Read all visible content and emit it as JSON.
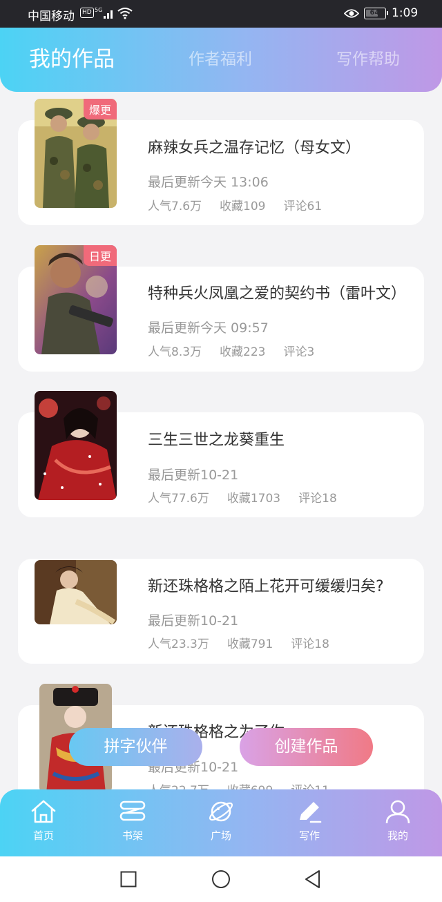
{
  "status_bar": {
    "carrier": "中国移动",
    "hd": "HD",
    "network": "5G",
    "battery": "64",
    "battery_level": 0.64,
    "time": "1:09"
  },
  "header": {
    "tabs": [
      {
        "label": "我的作品"
      },
      {
        "label": "作者福利"
      },
      {
        "label": "写作帮助"
      }
    ]
  },
  "works": [
    {
      "title": "麻辣女兵之温存记忆（母女文）",
      "update": "最后更新今天 13:06",
      "popularity": "人气7.6万",
      "favorites": "收藏109",
      "comments": "评论61",
      "badge": "爆更"
    },
    {
      "title": "特种兵火凤凰之爱的契约书（雷叶文）",
      "update": "最后更新今天 09:57",
      "popularity": "人气8.3万",
      "favorites": "收藏223",
      "comments": "评论3",
      "badge": "日更"
    },
    {
      "title": "三生三世之龙葵重生",
      "update": "最后更新10-21",
      "popularity": "人气77.6万",
      "favorites": "收藏1703",
      "comments": "评论18"
    },
    {
      "title": "新还珠格格之陌上花开可缓缓归矣?",
      "update": "最后更新10-21",
      "popularity": "人气23.3万",
      "favorites": "收藏791",
      "comments": "评论18"
    },
    {
      "title": "新还珠格格之为了你",
      "update": "最后更新10-21",
      "popularity": "人气22.7万",
      "favorites": "收藏699",
      "comments": "评论11"
    }
  ],
  "floating_buttons": {
    "partner": "拼字伙伴",
    "create": "创建作品"
  },
  "tabbar": {
    "items": [
      {
        "label": "首页"
      },
      {
        "label": "书架"
      },
      {
        "label": "广场"
      },
      {
        "label": "写作"
      },
      {
        "label": "我的"
      }
    ]
  },
  "colors": {
    "accent_start": "#4cd3f4",
    "accent_end": "#bf98e6",
    "badge": "#f06a7a"
  }
}
